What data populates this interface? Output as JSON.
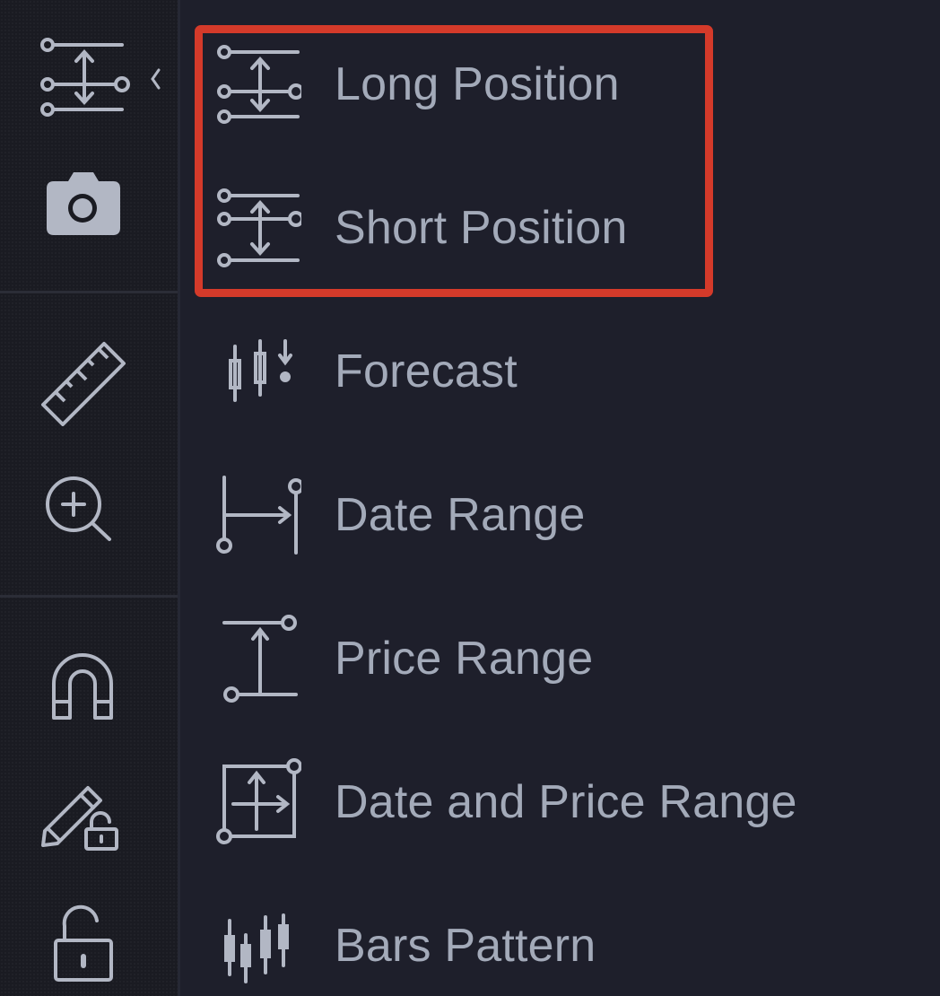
{
  "theme": {
    "sidebar_bg": "#1a1b22",
    "menu_bg": "#1e1f2b",
    "icon_color": "#b2b7c4",
    "text_color": "#a3aab9",
    "highlight_color": "#d43a2a"
  },
  "sidebar": {
    "items": [
      {
        "name": "long-position-tool",
        "icon": "long-position-icon",
        "has_expand_chevron": true
      },
      {
        "name": "screenshot-tool",
        "icon": "camera-icon"
      },
      {
        "name": "measure-tool",
        "icon": "ruler-icon"
      },
      {
        "name": "zoom-in-tool",
        "icon": "zoom-in-icon"
      },
      {
        "name": "magnet-mode",
        "icon": "magnet-icon"
      },
      {
        "name": "lock-drawings",
        "icon": "pencil-lock-icon"
      },
      {
        "name": "lock-all",
        "icon": "lock-open-icon"
      }
    ]
  },
  "menu": {
    "items": [
      {
        "label": "Long Position",
        "icon": "long-position-icon"
      },
      {
        "label": "Short Position",
        "icon": "short-position-icon"
      },
      {
        "label": "Forecast",
        "icon": "forecast-icon"
      },
      {
        "label": "Date Range",
        "icon": "date-range-icon"
      },
      {
        "label": "Price Range",
        "icon": "price-range-icon"
      },
      {
        "label": "Date and Price Range",
        "icon": "date-price-range-icon"
      },
      {
        "label": "Bars Pattern",
        "icon": "bars-pattern-icon"
      }
    ],
    "highlighted_items": [
      "Long Position",
      "Short Position"
    ]
  }
}
